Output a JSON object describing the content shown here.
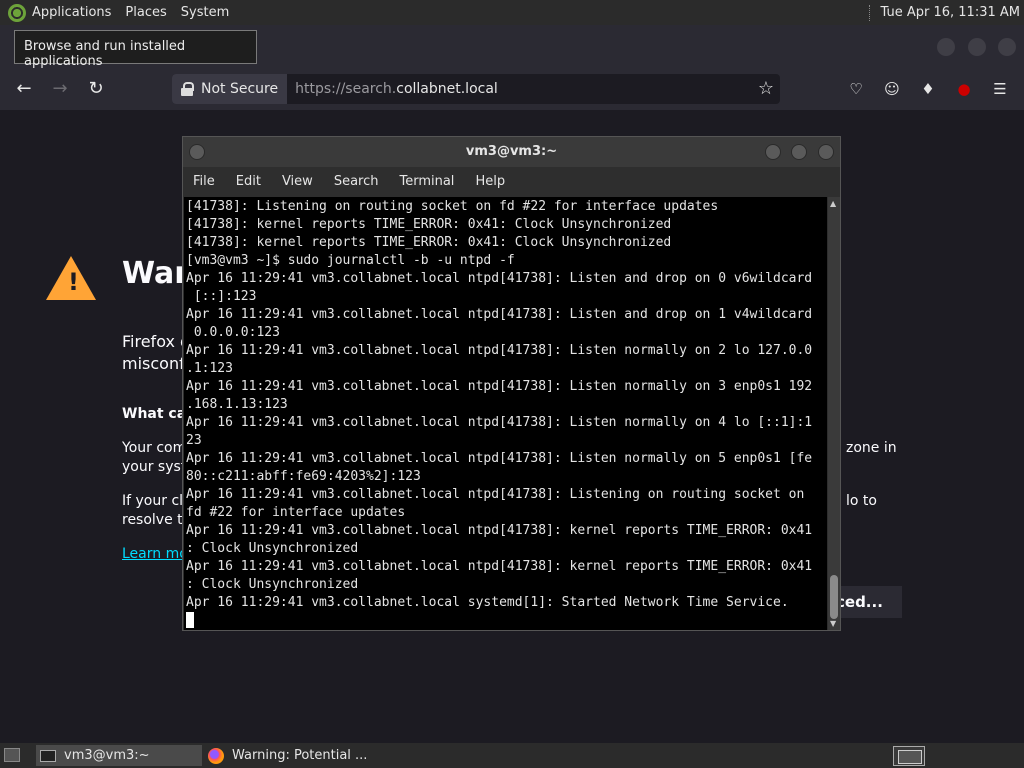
{
  "top_panel": {
    "menus": [
      "Applications",
      "Places",
      "System"
    ],
    "clock": "Tue Apr 16, 11:31 AM"
  },
  "tooltip": "Browse and run installed applications",
  "browser": {
    "url_security": "Not Secure",
    "url_scheme": "https://search.",
    "url_domain": "collabnet.local",
    "page": {
      "title_partial": "War",
      "para1_line1": "Firefox d",
      "para1_line2": "misconf",
      "heading_partial": "What can",
      "para2_line1": "Your com",
      "para2_line1_right": "zone in",
      "para2_line2": "your syst",
      "para3_line1": "If your clo",
      "para3_line1_right": "lo to",
      "para3_line2": "resolve th",
      "learn_more": "Learn mo",
      "advanced_partial": "ced..."
    }
  },
  "terminal": {
    "title": "vm3@vm3:~",
    "menu": [
      "File",
      "Edit",
      "View",
      "Search",
      "Terminal",
      "Help"
    ],
    "lines": [
      "[41738]: Listening on routing socket on fd #22 for interface updates",
      "[41738]: kernel reports TIME_ERROR: 0x41: Clock Unsynchronized",
      "[41738]: kernel reports TIME_ERROR: 0x41: Clock Unsynchronized",
      "[vm3@vm3 ~]$ sudo journalctl -b -u ntpd -f",
      "Apr 16 11:29:41 vm3.collabnet.local ntpd[41738]: Listen and drop on 0 v6wildcard",
      " [::]:123",
      "Apr 16 11:29:41 vm3.collabnet.local ntpd[41738]: Listen and drop on 1 v4wildcard",
      " 0.0.0.0:123",
      "Apr 16 11:29:41 vm3.collabnet.local ntpd[41738]: Listen normally on 2 lo 127.0.0",
      ".1:123",
      "Apr 16 11:29:41 vm3.collabnet.local ntpd[41738]: Listen normally on 3 enp0s1 192",
      ".168.1.13:123",
      "Apr 16 11:29:41 vm3.collabnet.local ntpd[41738]: Listen normally on 4 lo [::1]:1",
      "23",
      "Apr 16 11:29:41 vm3.collabnet.local ntpd[41738]: Listen normally on 5 enp0s1 [fe",
      "80::c211:abff:fe69:4203%2]:123",
      "Apr 16 11:29:41 vm3.collabnet.local ntpd[41738]: Listening on routing socket on",
      "fd #22 for interface updates",
      "Apr 16 11:29:41 vm3.collabnet.local ntpd[41738]: kernel reports TIME_ERROR: 0x41",
      ": Clock Unsynchronized",
      "Apr 16 11:29:41 vm3.collabnet.local ntpd[41738]: kernel reports TIME_ERROR: 0x41",
      ": Clock Unsynchronized",
      "Apr 16 11:29:41 vm3.collabnet.local systemd[1]: Started Network Time Service."
    ]
  },
  "taskbar": {
    "tasks": [
      "vm3@vm3:~",
      "Warning: Potential ..."
    ]
  },
  "colors": {
    "accent_link": "#00ddff",
    "warning": "#ffa436",
    "terminal_bg": "#000000"
  }
}
